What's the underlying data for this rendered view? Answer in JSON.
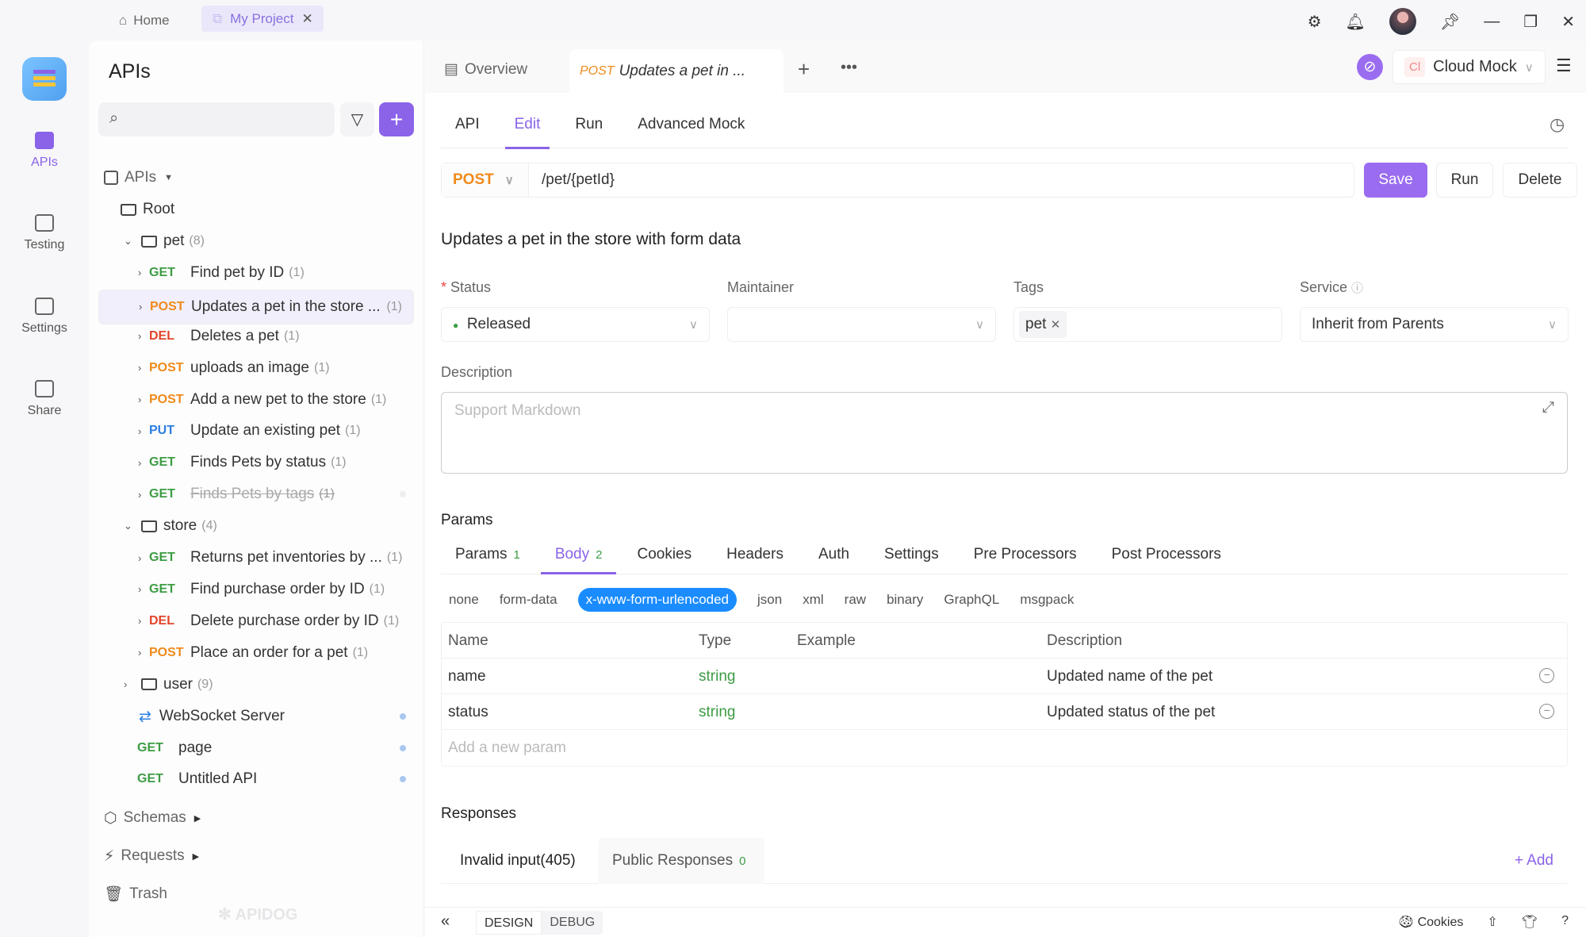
{
  "topbar": {
    "home": "Home",
    "project": "My Project"
  },
  "rail": [
    {
      "label": "APIs"
    },
    {
      "label": "Testing"
    },
    {
      "label": "Settings"
    },
    {
      "label": "Share"
    }
  ],
  "sidebar": {
    "title": "APIs",
    "root_label": "APIs",
    "root": "Root",
    "tree": [
      {
        "kind": "folder",
        "label": "pet",
        "count": "(8)",
        "open": true
      },
      {
        "method": "GET",
        "label": "Find pet by ID",
        "count": "(1)"
      },
      {
        "method": "POST",
        "label": "Updates a pet in the store ...",
        "count": "(1)",
        "selected": true
      },
      {
        "method": "DEL",
        "label": "Deletes a pet",
        "count": "(1)"
      },
      {
        "method": "POST",
        "label": "uploads an image",
        "count": "(1)"
      },
      {
        "method": "POST",
        "label": "Add a new pet to the store",
        "count": "(1)"
      },
      {
        "method": "PUT",
        "label": "Update an existing pet",
        "count": "(1)"
      },
      {
        "method": "GET",
        "label": "Finds Pets by status",
        "count": "(1)"
      },
      {
        "method": "GET",
        "label": "Finds Pets by tags",
        "count": "(1)",
        "deprecated": true
      },
      {
        "kind": "folder",
        "label": "store",
        "count": "(4)",
        "open": true
      },
      {
        "method": "GET",
        "label": "Returns pet inventories by ...",
        "count": "(1)"
      },
      {
        "method": "GET",
        "label": "Find purchase order by ID",
        "count": "(1)"
      },
      {
        "method": "DEL",
        "label": "Delete purchase order by ID",
        "count": "(1)"
      },
      {
        "method": "POST",
        "label": "Place an order for a pet",
        "count": "(1)"
      },
      {
        "kind": "folder",
        "label": "user",
        "count": "(9)",
        "open": false
      }
    ],
    "loose": [
      {
        "label": "WebSocket Server"
      },
      {
        "method": "GET",
        "label": "page"
      },
      {
        "method": "GET",
        "label": "Untitled API"
      }
    ],
    "sections": [
      "Schemas",
      "Requests",
      "Trash"
    ],
    "watermark": "APIDOG"
  },
  "tabs": {
    "overview": "Overview",
    "active_method": "POST",
    "active_title": "Updates a pet in ...",
    "env": "Cloud Mock",
    "env_badge": "Cl"
  },
  "subtabs": [
    "API",
    "Edit",
    "Run",
    "Advanced Mock"
  ],
  "request": {
    "method": "POST",
    "path": "/pet/{petId}",
    "save": "Save",
    "run": "Run",
    "delete": "Delete"
  },
  "title": "Updates a pet in the store with form data",
  "fields": {
    "status_label": "Status",
    "status": "Released",
    "maintainer_label": "Maintainer",
    "tags_label": "Tags",
    "tag": "pet",
    "service_label": "Service",
    "service": "Inherit from Parents"
  },
  "description": {
    "label": "Description",
    "placeholder": "Support Markdown"
  },
  "params": {
    "label": "Params",
    "tabs": [
      {
        "label": "Params",
        "badge": "1"
      },
      {
        "label": "Body",
        "badge": "2"
      },
      {
        "label": "Cookies"
      },
      {
        "label": "Headers"
      },
      {
        "label": "Auth"
      },
      {
        "label": "Settings"
      },
      {
        "label": "Pre Processors"
      },
      {
        "label": "Post Processors"
      }
    ],
    "body_types": [
      "none",
      "form-data",
      "x-www-form-urlencoded",
      "json",
      "xml",
      "raw",
      "binary",
      "GraphQL",
      "msgpack"
    ],
    "columns": [
      "Name",
      "Type",
      "Example",
      "Description"
    ],
    "rows": [
      {
        "name": "name",
        "type": "string",
        "desc": "Updated name of the pet"
      },
      {
        "name": "status",
        "type": "string",
        "desc": "Updated status of the pet"
      }
    ],
    "add_placeholder": "Add a new param"
  },
  "responses": {
    "label": "Responses",
    "tab": "Invalid input(405)",
    "public": "Public Responses",
    "public_count": "0",
    "add": "+ Add"
  },
  "bottom": {
    "design": "DESIGN",
    "debug": "DEBUG",
    "cookies": "Cookies"
  },
  "colors": {
    "accent": "#8a63e8",
    "get": "#3d9c44",
    "post": "#ef8a1a",
    "del": "#e2452b",
    "put": "#2b7fe0",
    "body_type": "#1a8cff"
  }
}
